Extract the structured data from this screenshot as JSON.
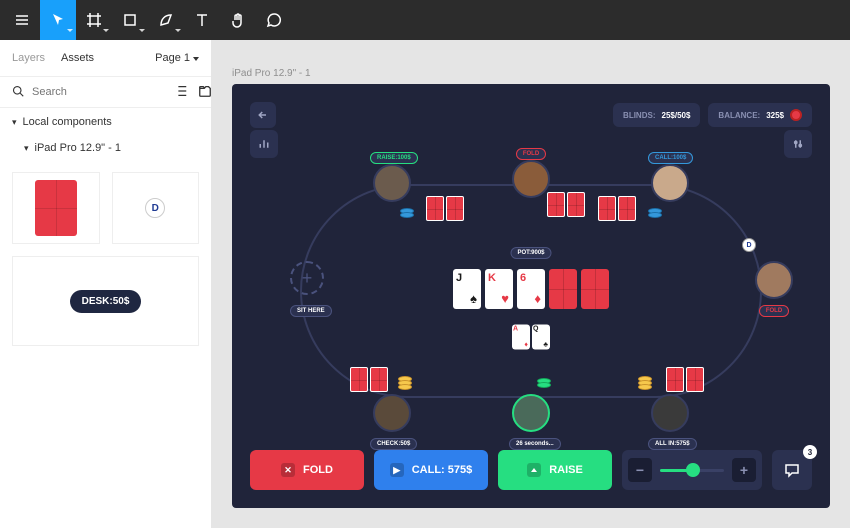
{
  "topbar": {
    "tools": [
      "menu",
      "move",
      "frame",
      "rectangle",
      "pen",
      "text",
      "hand",
      "comment"
    ]
  },
  "sidebar": {
    "tabs": {
      "layers": "Layers",
      "assets": "Assets"
    },
    "page": "Page 1",
    "search_placeholder": "Search",
    "section_local": "Local components",
    "frame_item": "iPad Pro 12.9\" - 1",
    "d_label": "D",
    "desk_label": "DESK:50$"
  },
  "frame_label": "iPad Pro 12.9\" - 1",
  "header": {
    "blinds_label": "BLINDS:",
    "blinds_value": "25$/50$",
    "balance_label": "BALANCE:",
    "balance_value": "325$"
  },
  "pot_label": "POT:900$",
  "community": [
    {
      "rank": "J",
      "suit": "♠",
      "color": "black"
    },
    {
      "rank": "K",
      "suit": "♥",
      "color": "red"
    },
    {
      "rank": "6",
      "suit": "♦",
      "color": "red"
    },
    {
      "back": true
    },
    {
      "back": true
    }
  ],
  "my_cards": [
    {
      "rank": "A",
      "suit": "♦",
      "color": "red"
    },
    {
      "rank": "Q",
      "suit": "♣",
      "color": "black"
    }
  ],
  "sit_here": "SIT HERE",
  "seats": {
    "top_left": {
      "tag": "RAISE:100$",
      "tag_class": "green"
    },
    "top_mid": {
      "tag": "FOLD",
      "tag_class": "red"
    },
    "top_right": {
      "tag": "CALL:100$",
      "tag_class": "blue"
    },
    "right": {
      "tag": "FOLD",
      "tag_class": "red"
    },
    "bot_left": {
      "tag": "CHECK:50$",
      "tag_class": ""
    },
    "bot_mid": {
      "tag": "26 seconds...",
      "tag_class": ""
    },
    "bot_right": {
      "tag": "ALL IN:575$",
      "tag_class": ""
    }
  },
  "dealer_label": "D",
  "actions": {
    "fold": "FOLD",
    "call": "CALL: 575$",
    "raise": "RAISE"
  },
  "chat_count": "3"
}
